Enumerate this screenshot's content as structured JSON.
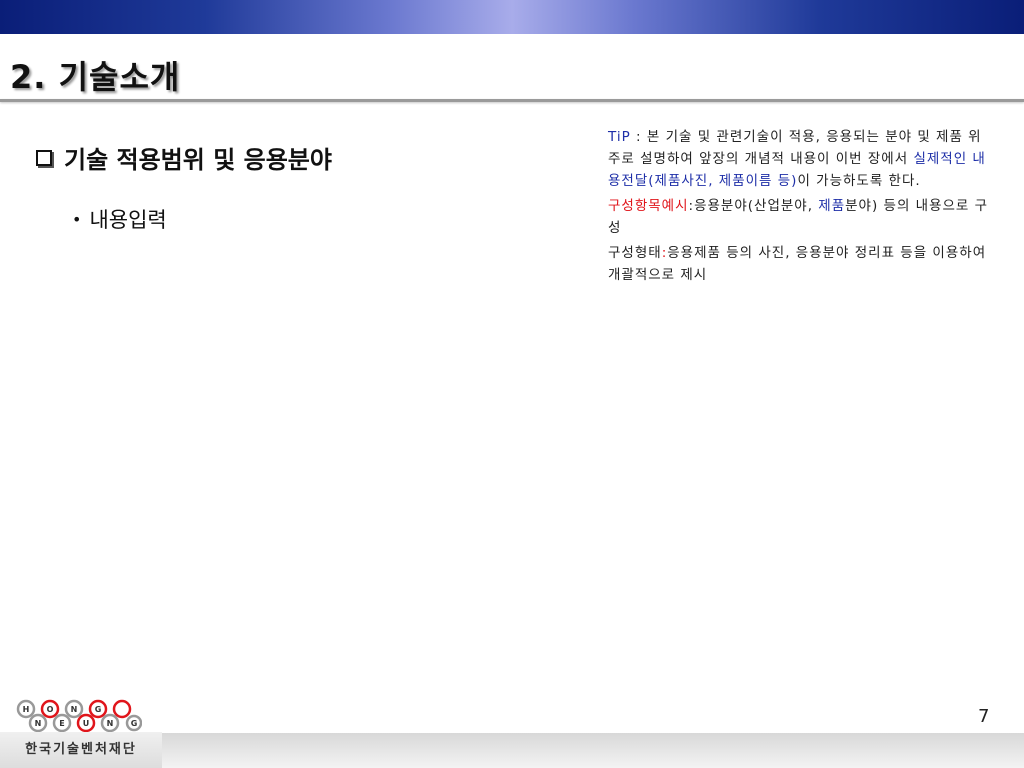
{
  "slide": {
    "title": "2. 기술소개",
    "heading": "기술 적용범위 및 응용분야",
    "bullet": "내용입력",
    "page_number": "7"
  },
  "tip": {
    "label": "TiP",
    "sep": " : 본 기술 및 관련기술이 적용, 응용되는 분야 및 제품 위주로 설명하여 앞장의 개념적 내용이 이번 장에서 ",
    "highlight": "실제적인 내용전달(제품사진, 제품이름 등)",
    "tail": "이 가능하도록 한다.",
    "example_label": "구성항목예시",
    "example_text_1": ":응용분야(산업분야, ",
    "example_product": "제품",
    "example_text_2": "분야) 등의 내용으로 구성",
    "form_label": "구성형태",
    "form_colon": ":",
    "form_text": "응용제품 등의 사진, 응용분야 정리표 등을 이용하여 개괄적으로 제시"
  },
  "logo": {
    "letters_top": [
      "H",
      "O",
      "N",
      "G"
    ],
    "letters_bottom": [
      "N",
      "E",
      "U",
      "N",
      "G"
    ],
    "org_name": "한국기술벤처재단"
  },
  "colors": {
    "accent_blue": "#1e2fa8",
    "accent_red": "#e0151b",
    "band_dark": "#0a1e78"
  }
}
